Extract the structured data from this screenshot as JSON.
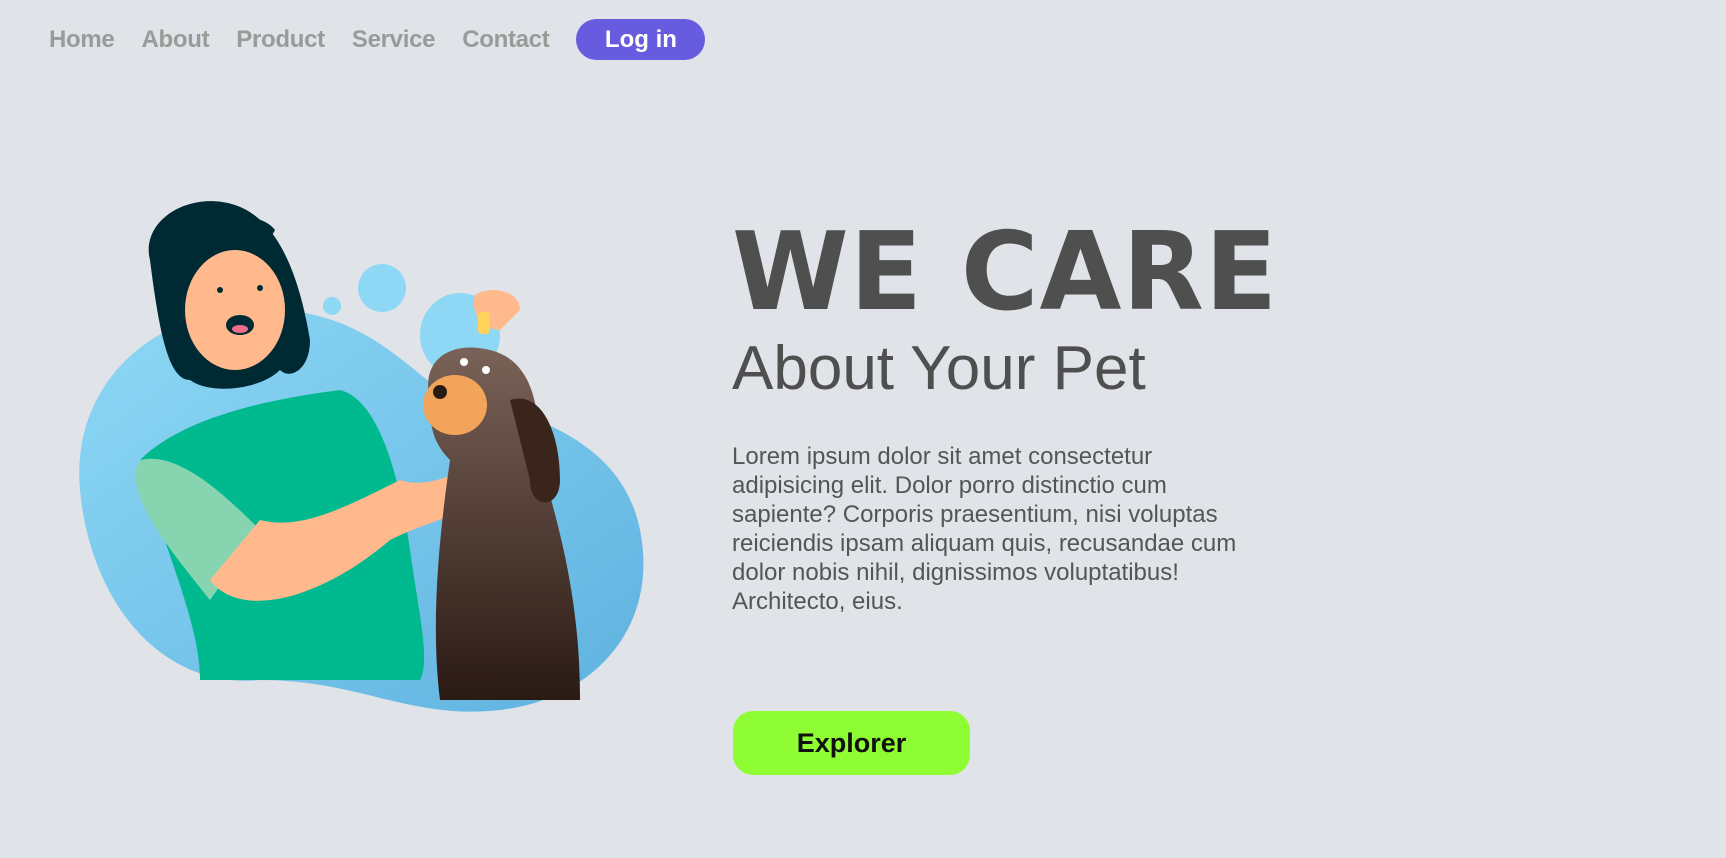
{
  "nav": {
    "items": [
      "Home",
      "About",
      "Product",
      "Service",
      "Contact"
    ],
    "login_label": "Log in"
  },
  "hero": {
    "title": "WE CARE",
    "subtitle": "About Your Pet",
    "body": "Lorem ipsum dolor sit amet consectetur adipisicing elit. Dolor porro distinctio cum sapiente? Corporis praesentium, nisi voluptas reiciendis ipsam aliquam quis, recusandae cum dolor nobis nihil, dignissimos voluptatibus! Architecto, eius.",
    "cta_label": "Explorer"
  },
  "colors": {
    "accent": "#675ce0",
    "cta": "#8ffd33",
    "background": "#e0e3e8"
  }
}
